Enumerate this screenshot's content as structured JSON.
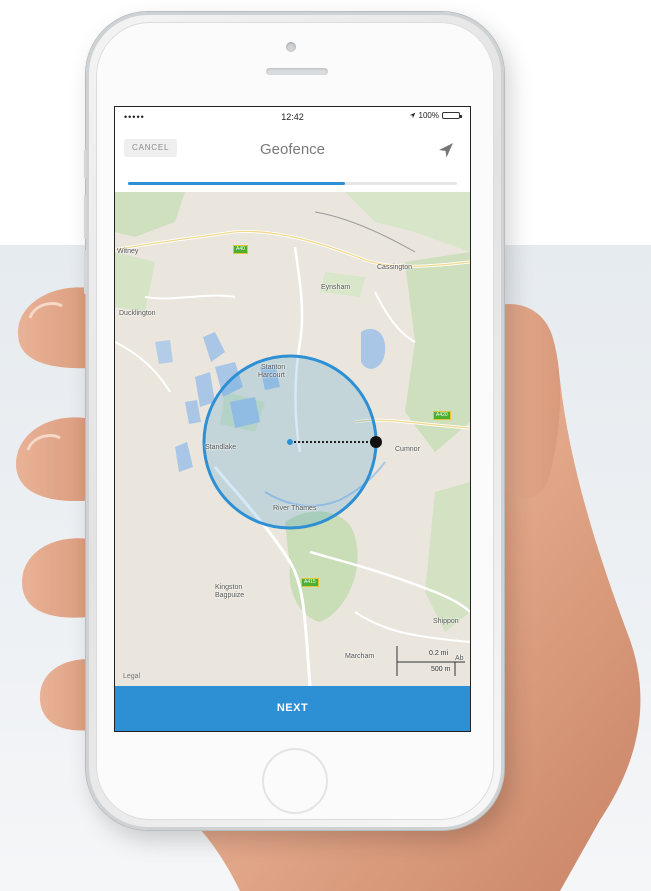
{
  "status_bar": {
    "carrier": "•••••",
    "time": "12:42",
    "battery": "100%"
  },
  "navbar": {
    "cancel_label": "CANCEL",
    "title": "Geofence",
    "location_icon": "location-arrow-icon"
  },
  "progress": {
    "fraction": 0.66
  },
  "map": {
    "places": {
      "witney": "Witney",
      "eynsham": "Eynsham",
      "cassington": "Cassington",
      "ducklington": "Ducklington",
      "stanton_line1": "Stanton",
      "stanton_line2": "Harcourt",
      "standlake": "Standlake",
      "cumnor": "Cumnor",
      "kingston_line1": "Kingston",
      "kingston_line2": "Bagpuize",
      "marcham": "Marcham",
      "shippon": "Shippon",
      "abingdon": "Ab",
      "river": "River Thames"
    },
    "road_badges": {
      "a40": "A40",
      "a420_right": "A420",
      "a415": "A415"
    },
    "legal": "Legal",
    "scale_mi": "0.2 mi",
    "scale_m": "500 m"
  },
  "geofence": {
    "fill_color": "#2d8fd4",
    "handle_color": "#111111"
  },
  "next_label": "NEXT",
  "colors": {
    "accent": "#2d8fd4"
  }
}
